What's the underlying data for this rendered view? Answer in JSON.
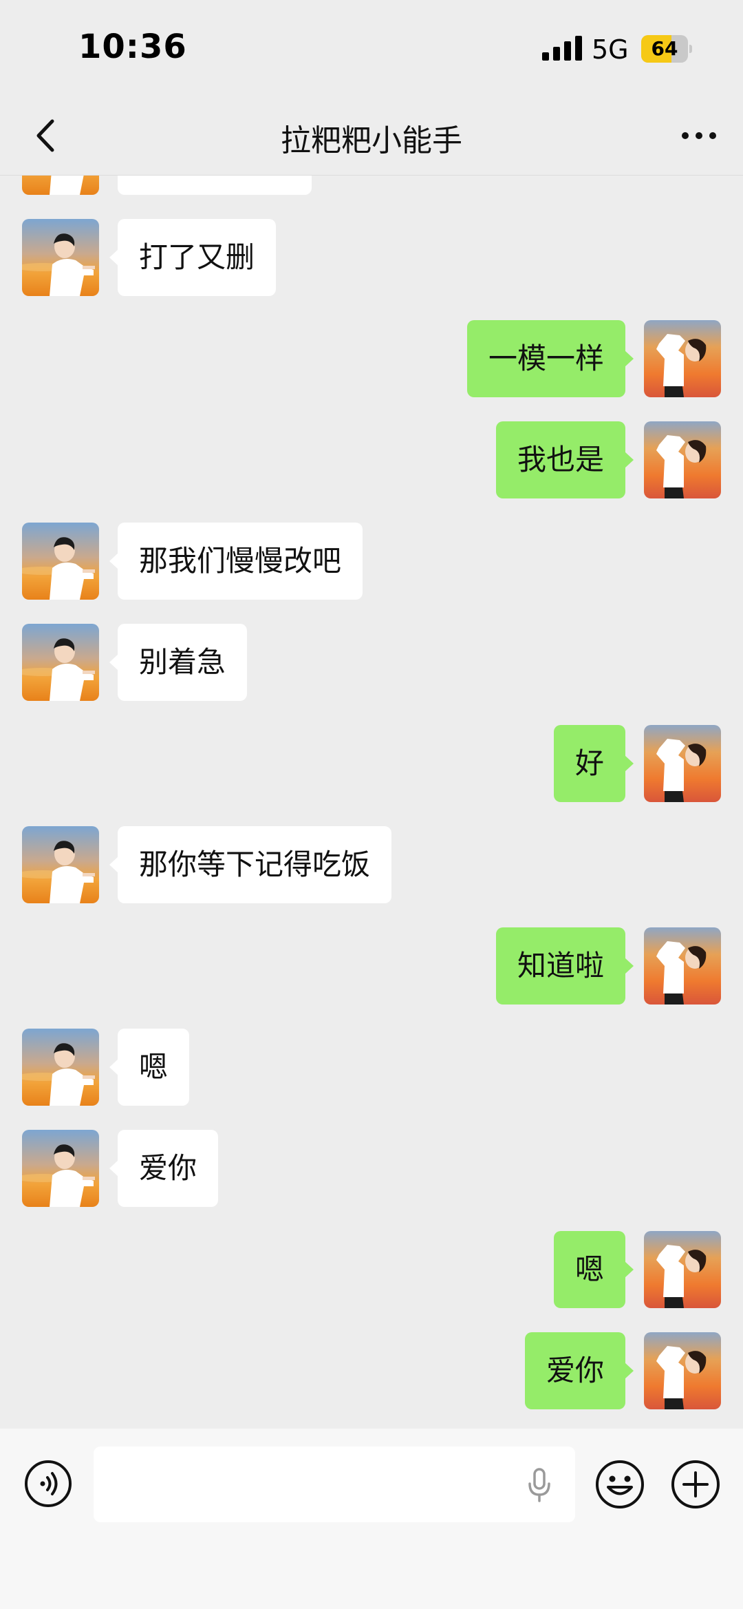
{
  "status_bar": {
    "time": "10:36",
    "network": "5G",
    "battery_level": "64",
    "battery_fraction": 0.64,
    "signal_icon": "signal-bars-icon",
    "battery_color": "#f6c916"
  },
  "nav": {
    "title": "拉粑粑小能手",
    "back_icon": "chevron-left-icon",
    "more_icon": "more-dots-icon"
  },
  "colors": {
    "background": "#ededed",
    "incoming_bubble": "#ffffff",
    "outgoing_bubble": "#95ec69"
  },
  "messages": [
    {
      "side": "in",
      "text": "打了又删"
    },
    {
      "side": "out",
      "text": "一模一样"
    },
    {
      "side": "out",
      "text": "我也是"
    },
    {
      "side": "in",
      "text": "那我们慢慢改吧"
    },
    {
      "side": "in",
      "text": "别着急"
    },
    {
      "side": "out",
      "text": "好"
    },
    {
      "side": "in",
      "text": "那你等下记得吃饭"
    },
    {
      "side": "out",
      "text": "知道啦"
    },
    {
      "side": "in",
      "text": "嗯"
    },
    {
      "side": "in",
      "text": "爱你"
    },
    {
      "side": "out",
      "text": "嗯"
    },
    {
      "side": "out",
      "text": "爱你"
    }
  ],
  "input_bar": {
    "value": "",
    "voice_icon": "voice-input-icon",
    "mic_icon": "microphone-icon",
    "emoji_icon": "emoji-icon",
    "plus_icon": "plus-icon"
  }
}
